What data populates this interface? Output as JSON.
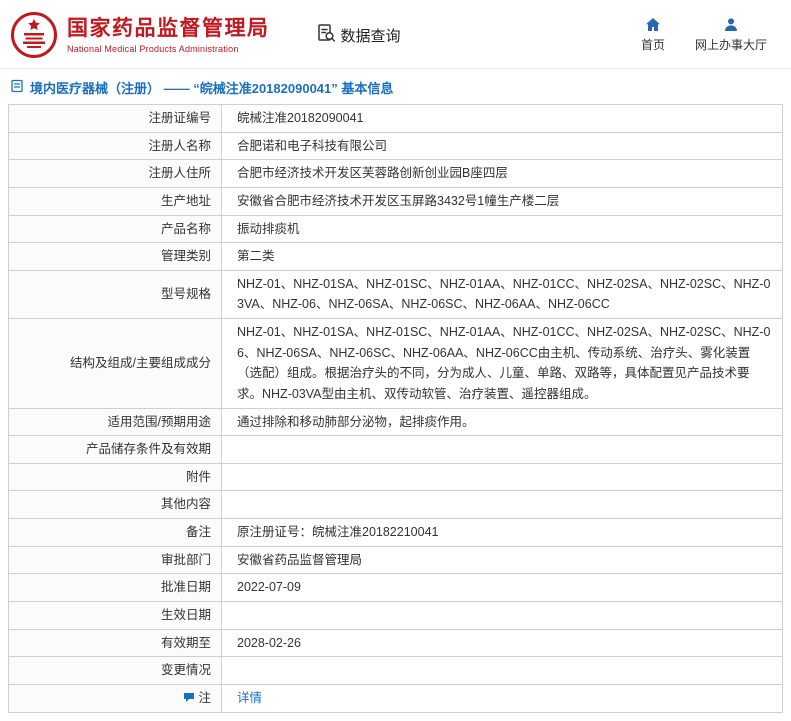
{
  "colors": {
    "brand_red": "#c01920",
    "link_blue": "#1a6fc0",
    "icon_blue": "#2a66b0",
    "table_border": "#cfcfcf"
  },
  "header": {
    "org_name_cn": "国家药品监督管理局",
    "org_name_en": "National Medical Products Administration",
    "data_query_label": "数据查询",
    "home_label": "首页",
    "service_hall_label": "网上办事大厅"
  },
  "page_title": {
    "text": "境内医疗器械（注册） —— “皖械注准20182090041” 基本信息"
  },
  "table": {
    "rows": [
      {
        "label": "注册证编号",
        "value": "皖械注准20182090041"
      },
      {
        "label": "注册人名称",
        "value": "合肥诺和电子科技有限公司"
      },
      {
        "label": "注册人住所",
        "value": "合肥市经济技术开发区芙蓉路创新创业园B座四层"
      },
      {
        "label": "生产地址",
        "value": "安徽省合肥市经济技术开发区玉屏路3432号1幢生产楼二层"
      },
      {
        "label": "产品名称",
        "value": "振动排痰机"
      },
      {
        "label": "管理类别",
        "value": "第二类"
      },
      {
        "label": "型号规格",
        "value": "NHZ-01、NHZ-01SA、NHZ-01SC、NHZ-01AA、NHZ-01CC、NHZ-02SA、NHZ-02SC、NHZ-03VA、NHZ-06、NHZ-06SA、NHZ-06SC、NHZ-06AA、NHZ-06CC"
      },
      {
        "label": "结构及组成/主要组成成分",
        "value": "NHZ-01、NHZ-01SA、NHZ-01SC、NHZ-01AA、NHZ-01CC、NHZ-02SA、NHZ-02SC、NHZ-06、NHZ-06SA、NHZ-06SC、NHZ-06AA、NHZ-06CC由主机、传动系统、治疗头、雾化装置（选配）组成。根据治疗头的不同，分为成人、儿童、单路、双路等，具体配置见产品技术要求。NHZ-03VA型由主机、双传动软管、治疗装置、遥控器组成。"
      },
      {
        "label": "适用范围/预期用途",
        "value": "通过排除和移动肺部分泌物，起排痰作用。"
      },
      {
        "label": "产品储存条件及有效期",
        "value": ""
      },
      {
        "label": "附件",
        "value": ""
      },
      {
        "label": "其他内容",
        "value": ""
      },
      {
        "label": "备注",
        "value": "原注册证号：皖械注准20182210041"
      },
      {
        "label": "审批部门",
        "value": "安徽省药品监督管理局"
      },
      {
        "label": "批准日期",
        "value": "2022-07-09"
      },
      {
        "label": "生效日期",
        "value": ""
      },
      {
        "label": "有效期至",
        "value": "2028-02-26"
      },
      {
        "label": "变更情况",
        "value": ""
      },
      {
        "label": "注",
        "value": "详情",
        "link": true,
        "icon": true
      }
    ]
  }
}
